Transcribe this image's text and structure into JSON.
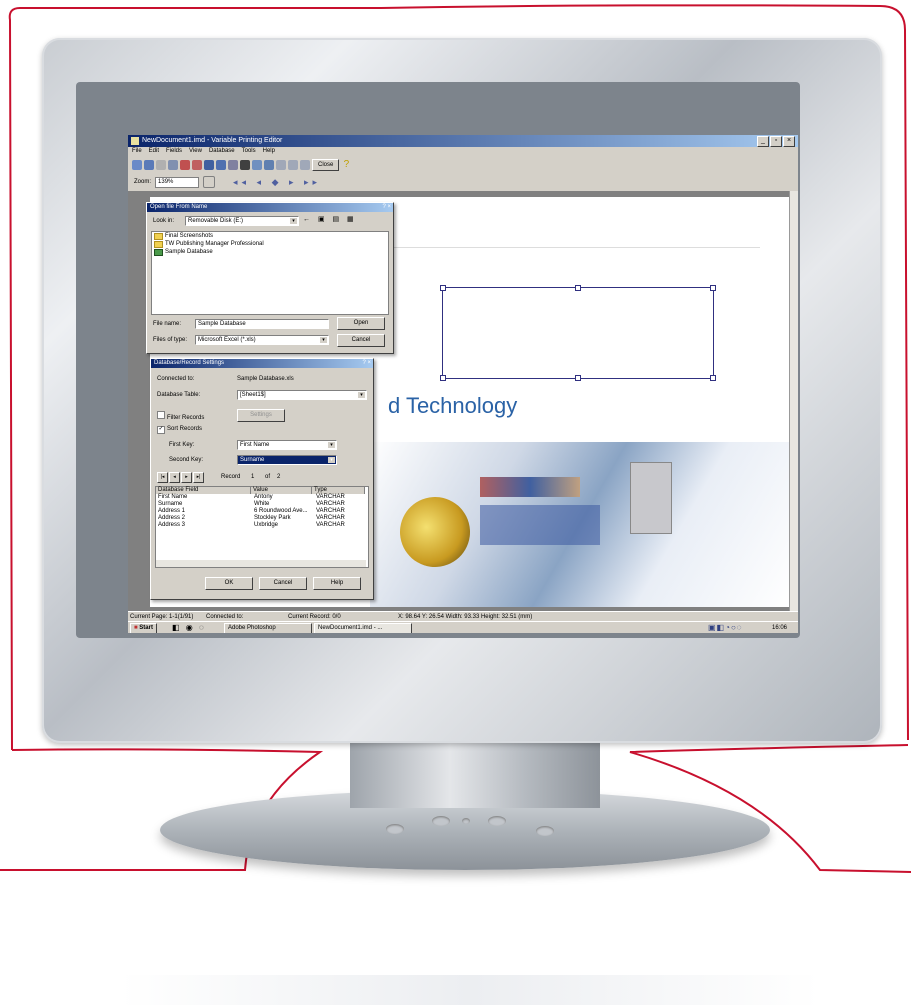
{
  "colors": {
    "accent_red": "#c8102e",
    "title_blue": "#0a246a",
    "brand_blue": "#2a62a6"
  },
  "app": {
    "title": "NewDocument1.imd - Variable Printing Editor",
    "menu": [
      "File",
      "Edit",
      "Fields",
      "View",
      "Database",
      "Tools",
      "Help"
    ],
    "close_label": "Close",
    "zoom_label": "Zoom:",
    "zoom_value": "139%"
  },
  "document": {
    "heading": "d Technology"
  },
  "open_dialog": {
    "title": "Open file From Name",
    "look_in_label": "Look in:",
    "look_in_value": "Removable Disk (E:)",
    "items": [
      "Final Screenshots",
      "TW Publishing Manager Professional",
      "Sample Database"
    ],
    "file_name_label": "File name:",
    "file_name_value": "Sample Database",
    "file_type_label": "Files of type:",
    "file_type_value": "Microsoft Excel (*.xls)",
    "open_label": "Open",
    "cancel_label": "Cancel"
  },
  "db_dialog": {
    "title": "Database/Record Settings",
    "connected_label": "Connected to:",
    "connected_value": "Sample Database.xls",
    "table_label": "Database Table:",
    "table_value": "[Sheet1$]",
    "filter_label": "Filter Records",
    "settings_label": "Settings",
    "sort_label": "Sort Records",
    "first_key_label": "First Key:",
    "first_key_value": "First Name",
    "second_key_label": "Second Key:",
    "second_key_value": "Surname",
    "record_label": "Record",
    "record_current": "1",
    "record_of": "of",
    "record_total": "2",
    "columns": [
      "Database Field",
      "Value",
      "Type"
    ],
    "rows": [
      [
        "First Name",
        "Antony",
        "VARCHAR"
      ],
      [
        "Surname",
        "White",
        "VARCHAR"
      ],
      [
        "Address 1",
        "6 Roundwood Ave...",
        "VARCHAR"
      ],
      [
        "Address 2",
        "Stockley Park",
        "VARCHAR"
      ],
      [
        "Address 3",
        "Uxbridge",
        "VARCHAR"
      ]
    ],
    "ok_label": "OK",
    "cancel_label": "Cancel",
    "help_label": "Help"
  },
  "status": {
    "page": "Current Page: 1-1(1/91)",
    "connected": "Connected to:",
    "record": "Current Record: 0/0",
    "coords": "X: 98.64  Y: 26.54  Width: 93.33  Height: 32.51 (mm)"
  },
  "taskbar": {
    "start": "Start",
    "tasks": [
      "Adobe Photoshop",
      "NewDocument1.imd - ..."
    ],
    "clock": "16:06"
  }
}
